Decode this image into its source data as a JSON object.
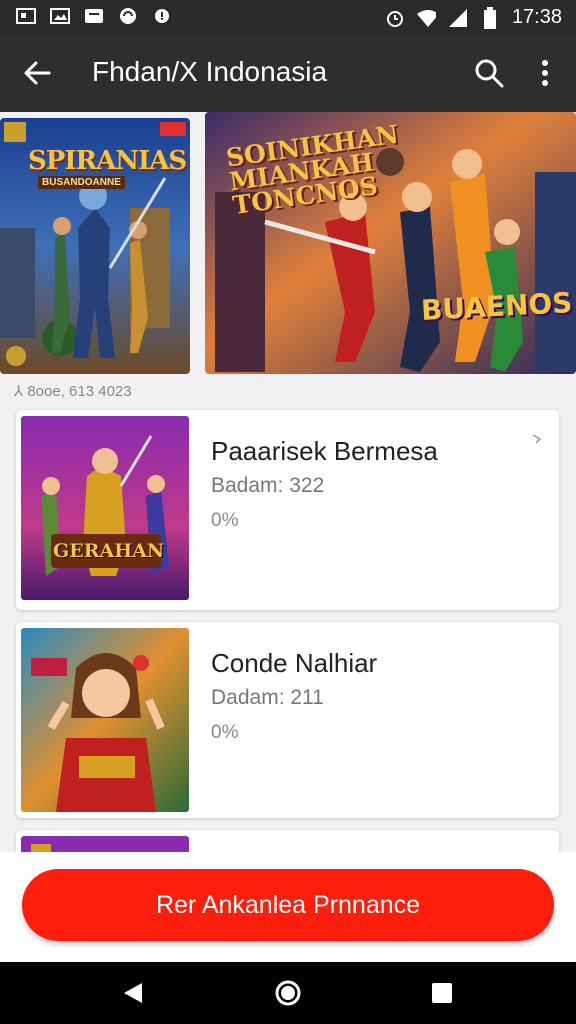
{
  "status_bar": {
    "time": "17:38",
    "icons": [
      "notification-icon",
      "image-icon",
      "app-icon",
      "sync-icon",
      "alert-icon",
      "alarm-icon",
      "wifi-icon",
      "signal-icon",
      "battery-icon"
    ]
  },
  "app_bar": {
    "title": "Fhdan/X Indonasia",
    "back_icon": "arrow-left-icon",
    "search_icon": "search-icon",
    "more_icon": "more-vertical-icon"
  },
  "banners": {
    "left_title": "SPIRANIAS",
    "left_subtitle": "BUSANDOANNE",
    "right_title": "SOINIKHAN MIANKAH TONCNOS",
    "right_subtitle": "BUAENOS",
    "meta": "⅄ 8ooe, 613 4023"
  },
  "items": [
    {
      "title": "Paaarisek Bermesa",
      "subtitle": "Badam: 322",
      "progress": "0%",
      "thumb_label": "GERAHAN"
    },
    {
      "title": "Conde Nalhiar",
      "subtitle": "Dadam: 211",
      "progress": "0%",
      "thumb_label": ""
    }
  ],
  "cta": {
    "label": "Rer Ankanlea Prnnance"
  },
  "nav": {
    "back_icon": "triangle-back-icon",
    "home_icon": "circle-home-icon",
    "recents_icon": "square-recents-icon"
  }
}
